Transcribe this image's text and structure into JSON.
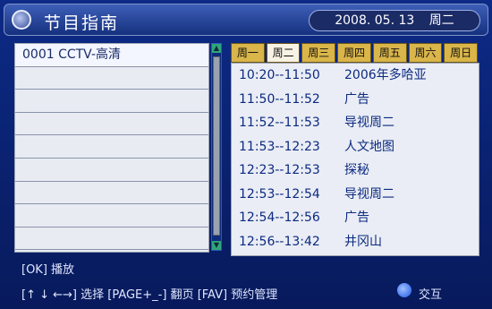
{
  "header": {
    "title": "节目指南",
    "date": "2008. 05. 13",
    "weekday": "周二"
  },
  "channels": [
    "0001  CCTV-高清",
    "",
    "",
    "",
    "",
    "",
    "",
    "",
    ""
  ],
  "days": [
    "周一",
    "周二",
    "周三",
    "周四",
    "周五",
    "周六",
    "周日"
  ],
  "active_day": "周二",
  "programs": [
    {
      "time": "10:20--11:50",
      "name": "2006年多哈亚"
    },
    {
      "time": "11:50--11:52",
      "name": "广告"
    },
    {
      "time": "11:52--11:53",
      "name": "导视周二"
    },
    {
      "time": "11:53--12:23",
      "name": "人文地图"
    },
    {
      "time": "12:23--12:53",
      "name": "探秘"
    },
    {
      "time": "12:53--12:54",
      "name": "导视周二"
    },
    {
      "time": "12:54--12:56",
      "name": "广告"
    },
    {
      "time": "12:56--13:42",
      "name": "井冈山"
    }
  ],
  "footer": {
    "ok": "[OK]  播放",
    "nav": "[↑ ↓ ←→] 选择    [PAGE+_-] 翻页    [FAV] 预约管理",
    "interact": "交互"
  },
  "colors": {
    "background": "#0a1f6e",
    "tab": "#d9b54a",
    "tab_active": "#f7f2e4"
  }
}
